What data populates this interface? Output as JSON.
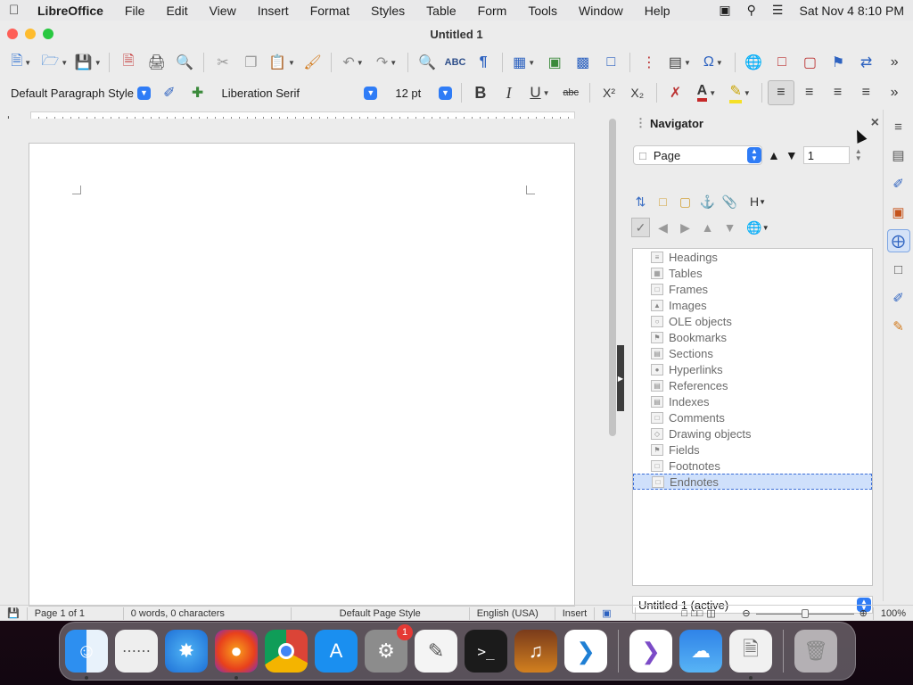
{
  "menubar": {
    "app_name": "LibreOffice",
    "items": [
      "File",
      "Edit",
      "View",
      "Insert",
      "Format",
      "Styles",
      "Table",
      "Form",
      "Tools",
      "Window",
      "Help"
    ],
    "datetime": "Sat Nov 4  8:10 PM"
  },
  "window": {
    "title": "Untitled 1"
  },
  "format_toolbar": {
    "paragraph_style": "Default Paragraph Style",
    "font_name": "Liberation Serif",
    "font_size": "12 pt",
    "bold": "B",
    "italic": "I",
    "underline": "U",
    "strikethrough": "abc",
    "superscript": "X²",
    "subscript": "X₂"
  },
  "navigator": {
    "title": "Navigator",
    "navigate_by": "Page",
    "page_number": "1",
    "categories": [
      "Headings",
      "Tables",
      "Frames",
      "Images",
      "OLE objects",
      "Bookmarks",
      "Sections",
      "Hyperlinks",
      "References",
      "Indexes",
      "Comments",
      "Drawing objects",
      "Fields",
      "Footnotes",
      "Endnotes"
    ],
    "selected_category": "Endnotes",
    "document": "Untitled 1 (active)"
  },
  "statusbar": {
    "page": "Page 1 of 1",
    "word_count": "0 words, 0 characters",
    "page_style": "Default Page Style",
    "language": "English (USA)",
    "insert_mode": "Insert",
    "zoom": "100%",
    "zoom_level": 1.0
  },
  "dock": {
    "apps": [
      "Finder",
      "Launchpad",
      "Safari",
      "Firefox",
      "Chrome",
      "App Store",
      "System Settings",
      "TextEdit",
      "Terminal",
      "GarageBand",
      "Visual Studio Code",
      "Visual Studio",
      "Weather",
      "Preview",
      "Trash"
    ],
    "settings_badge": "1"
  },
  "colors": {
    "accent": "#2f7cf6",
    "selection": "#cfe0fb",
    "font_color": "#c62828",
    "highlight": "#f5e027"
  }
}
